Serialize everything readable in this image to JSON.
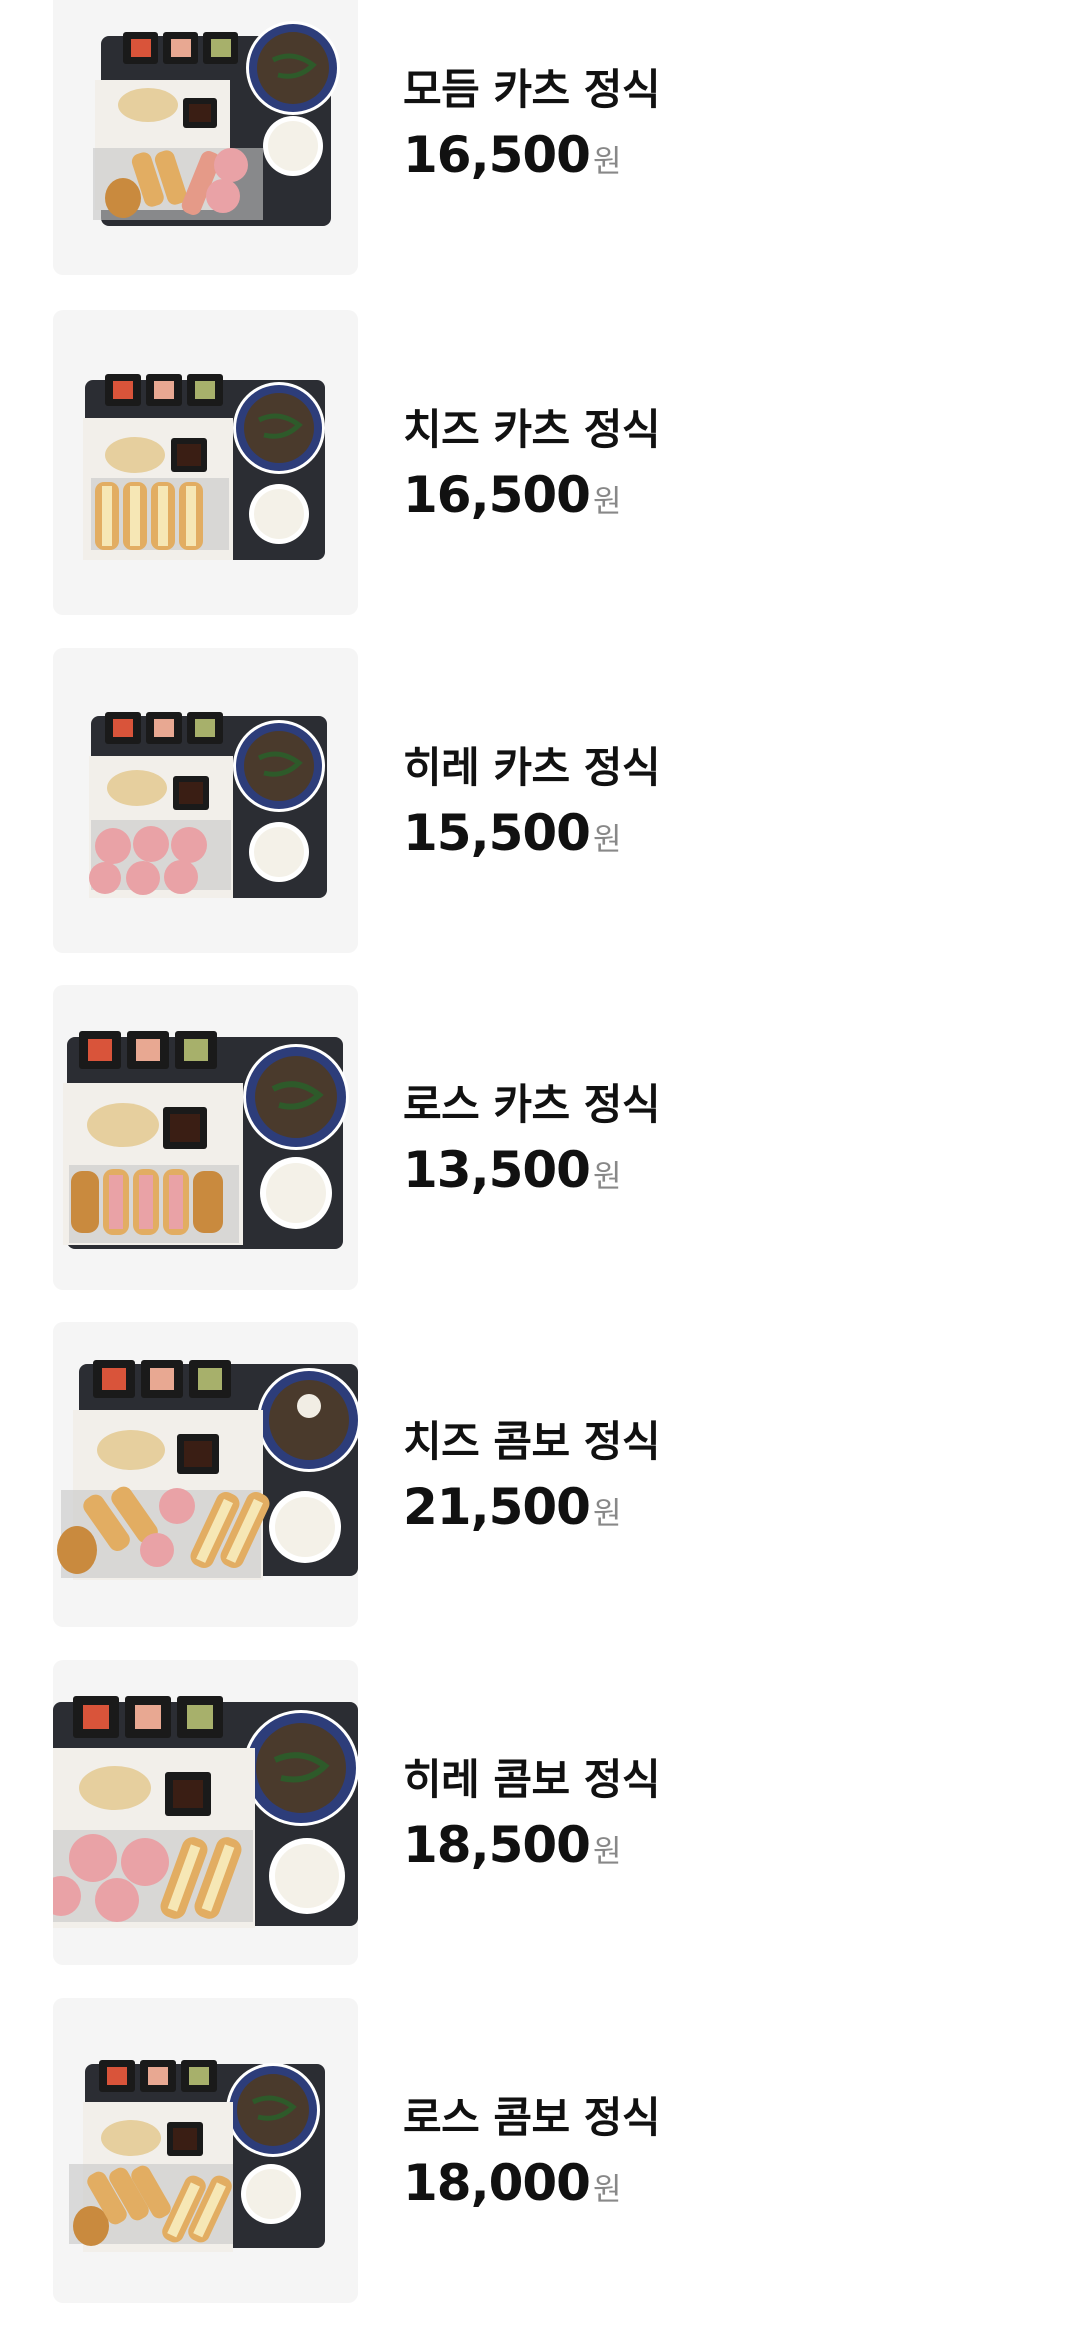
{
  "menu": {
    "items": [
      {
        "name": "모듬 카츠 정식",
        "price": "16,500",
        "currency": "원",
        "image_icon": "mixed-katsu-set-photo"
      },
      {
        "name": "치즈 카츠 정식",
        "price": "16,500",
        "currency": "원",
        "image_icon": "cheese-katsu-set-photo"
      },
      {
        "name": "히레 카츠 정식",
        "price": "15,500",
        "currency": "원",
        "image_icon": "hire-katsu-set-photo"
      },
      {
        "name": "로스 카츠 정식",
        "price": "13,500",
        "currency": "원",
        "image_icon": "rosu-katsu-set-photo"
      },
      {
        "name": "치즈 콤보 정식",
        "price": "21,500",
        "currency": "원",
        "image_icon": "cheese-combo-set-photo"
      },
      {
        "name": "히레 콤보 정식",
        "price": "18,500",
        "currency": "원",
        "image_icon": "hire-combo-set-photo"
      },
      {
        "name": "로스 콤보 정식",
        "price": "18,000",
        "currency": "원",
        "image_icon": "rosu-combo-set-photo"
      }
    ]
  },
  "colors": {
    "thumb_background": "#f5f5f5",
    "tray": "#2b2d33",
    "text_primary": "#111111",
    "currency_text": "#888888"
  }
}
